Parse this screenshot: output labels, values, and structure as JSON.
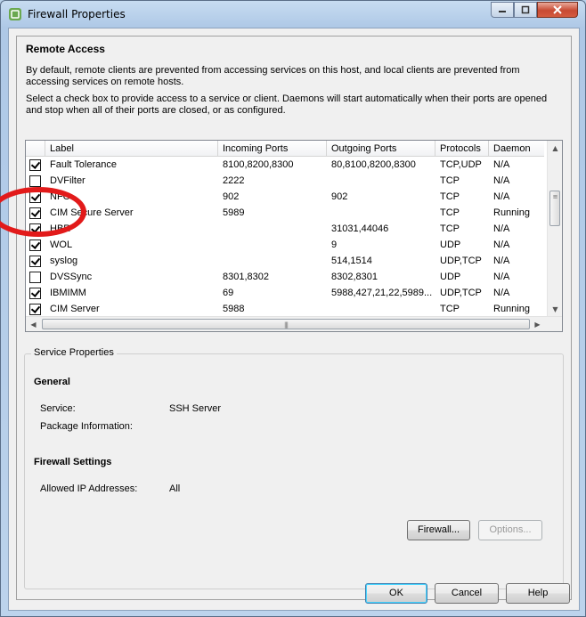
{
  "window": {
    "title": "Firewall Properties",
    "icon": "vsphere-logo-icon"
  },
  "remote_access": {
    "heading": "Remote Access",
    "description_1": "By default, remote clients are prevented from accessing services on this host, and local clients are prevented from accessing services on remote hosts.",
    "description_2": "Select a check box to provide access to a service or client. Daemons will start automatically when their ports are opened and stop when all of their ports are closed, or as configured."
  },
  "table": {
    "columns": [
      "Label",
      "Incoming Ports",
      "Outgoing Ports",
      "Protocols",
      "Daemon"
    ],
    "rows": [
      {
        "checked": true,
        "label": "Fault Tolerance",
        "incoming": "8100,8200,8300",
        "outgoing": "80,8100,8200,8300",
        "protocols": "TCP,UDP",
        "daemon": "N/A"
      },
      {
        "checked": false,
        "label": "DVFilter",
        "incoming": "2222",
        "outgoing": "",
        "protocols": "TCP",
        "daemon": "N/A"
      },
      {
        "checked": true,
        "label": "NFC",
        "incoming": "902",
        "outgoing": "902",
        "protocols": "TCP",
        "daemon": "N/A"
      },
      {
        "checked": true,
        "label": "CIM Secure Server",
        "incoming": "5989",
        "outgoing": "",
        "protocols": "TCP",
        "daemon": "Running"
      },
      {
        "checked": true,
        "label": "HBR",
        "incoming": "",
        "outgoing": "31031,44046",
        "protocols": "TCP",
        "daemon": "N/A"
      },
      {
        "checked": true,
        "label": "WOL",
        "incoming": "",
        "outgoing": "9",
        "protocols": "UDP",
        "daemon": "N/A"
      },
      {
        "checked": true,
        "label": "syslog",
        "incoming": "",
        "outgoing": "514,1514",
        "protocols": "UDP,TCP",
        "daemon": "N/A"
      },
      {
        "checked": false,
        "label": "DVSSync",
        "incoming": "8301,8302",
        "outgoing": "8302,8301",
        "protocols": "UDP",
        "daemon": "N/A"
      },
      {
        "checked": true,
        "label": "IBMIMM",
        "incoming": "69",
        "outgoing": "5988,427,21,22,5989...",
        "protocols": "UDP,TCP",
        "daemon": "N/A"
      },
      {
        "checked": true,
        "label": "CIM Server",
        "incoming": "5988",
        "outgoing": "",
        "protocols": "TCP",
        "daemon": "Running"
      }
    ]
  },
  "service_properties": {
    "legend": "Service Properties",
    "general_heading": "General",
    "service_label": "Service:",
    "service_value": "SSH Server",
    "package_label": "Package Information:",
    "package_value": "",
    "firewall_heading": "Firewall Settings",
    "allowed_ip_label": "Allowed IP Addresses:",
    "allowed_ip_value": "All",
    "firewall_button": "Firewall...",
    "options_button": "Options..."
  },
  "footer": {
    "ok": "OK",
    "cancel": "Cancel",
    "help": "Help"
  },
  "colors": {
    "annotation_circle": "#e21a1a",
    "close_button": "#c84a33"
  }
}
